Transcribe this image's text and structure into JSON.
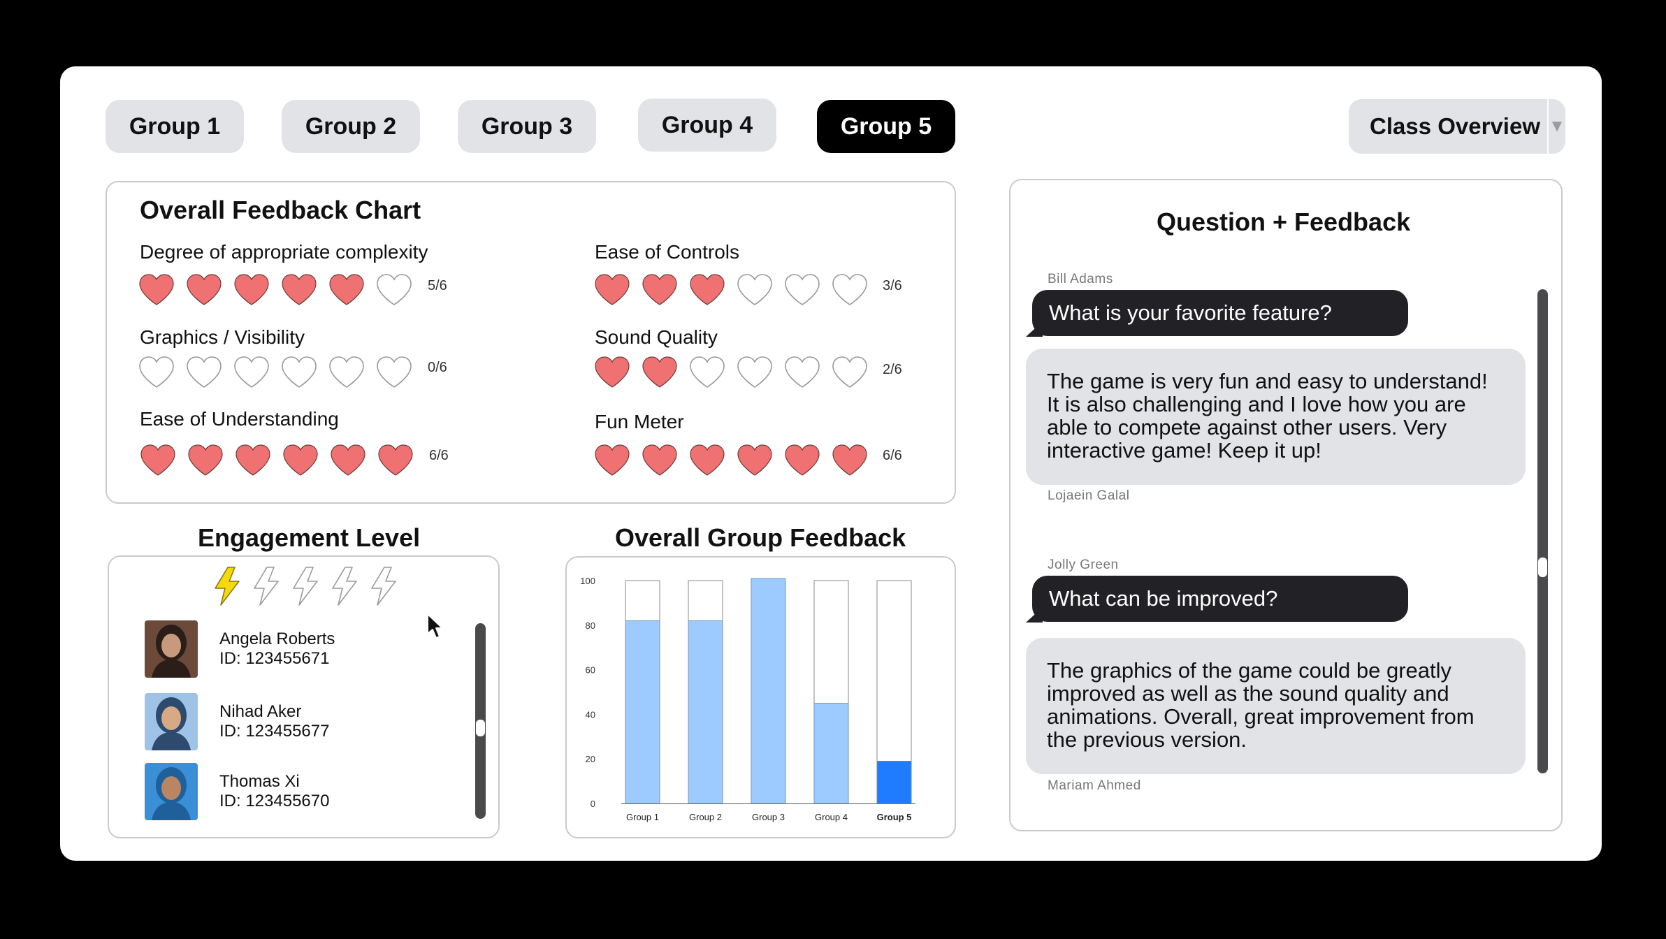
{
  "tabs": [
    {
      "label": "Group 1",
      "active": false
    },
    {
      "label": "Group 2",
      "active": false
    },
    {
      "label": "Group 3",
      "active": false
    },
    {
      "label": "Group 4",
      "active": false
    },
    {
      "label": "Group 5",
      "active": true
    }
  ],
  "view_select": {
    "selected": "Class Overview"
  },
  "feedback_chart": {
    "title": "Overall Feedback Chart",
    "metrics": [
      {
        "label": "Degree of appropriate complexity",
        "filled": 5,
        "total": 6,
        "score": "5/6"
      },
      {
        "label": "Ease of Controls",
        "filled": 3,
        "total": 6,
        "score": "3/6"
      },
      {
        "label": "Graphics / Visibility",
        "filled": 0,
        "total": 6,
        "score": "0/6"
      },
      {
        "label": "Sound Quality",
        "filled": 2,
        "total": 6,
        "score": "2/6"
      },
      {
        "label": "Ease of Understanding",
        "filled": 6,
        "total": 6,
        "score": "6/6"
      },
      {
        "label": "Fun Meter",
        "filled": 6,
        "total": 6,
        "score": "6/6"
      }
    ],
    "heart_color": "#f07171"
  },
  "engagement": {
    "title": "Engagement Level",
    "level": 1,
    "max": 5,
    "students": [
      {
        "name": "Angela Roberts",
        "id": "ID: 123455671"
      },
      {
        "name": "Nihad Aker",
        "id": "ID: 123455677"
      },
      {
        "name": "Thomas Xi",
        "id": "ID: 123455670"
      }
    ]
  },
  "group_feedback": {
    "title": "Overall Group Feedback"
  },
  "chart_data": {
    "type": "bar",
    "title": "Overall Group Feedback",
    "categories": [
      "Group 1",
      "Group 2",
      "Group 3",
      "Group 4",
      "Group 5"
    ],
    "values": [
      82,
      82,
      101,
      45,
      19
    ],
    "ylim": [
      0,
      100
    ],
    "yticks": [
      0,
      20,
      40,
      60,
      80,
      100
    ],
    "highlight": "Group 5",
    "colors": {
      "default": "#9ecbff",
      "highlight": "#1f7cff"
    }
  },
  "qa": {
    "title": "Question + Feedback",
    "threads": [
      {
        "asker": "Bill Adams",
        "question": "What is your favorite feature?",
        "answer": "The game is very fun and easy to understand! It is also challenging and I love how you are able to compete against other users. Very interactive game! Keep it up!",
        "responder": "Lojaein Galal"
      },
      {
        "asker": "Jolly Green",
        "question": "What can be improved?",
        "answer": "The graphics of the game could be greatly improved as well as the sound quality and animations. Overall, great improvement from the previous version.",
        "responder": "Mariam Ahmed"
      }
    ]
  }
}
